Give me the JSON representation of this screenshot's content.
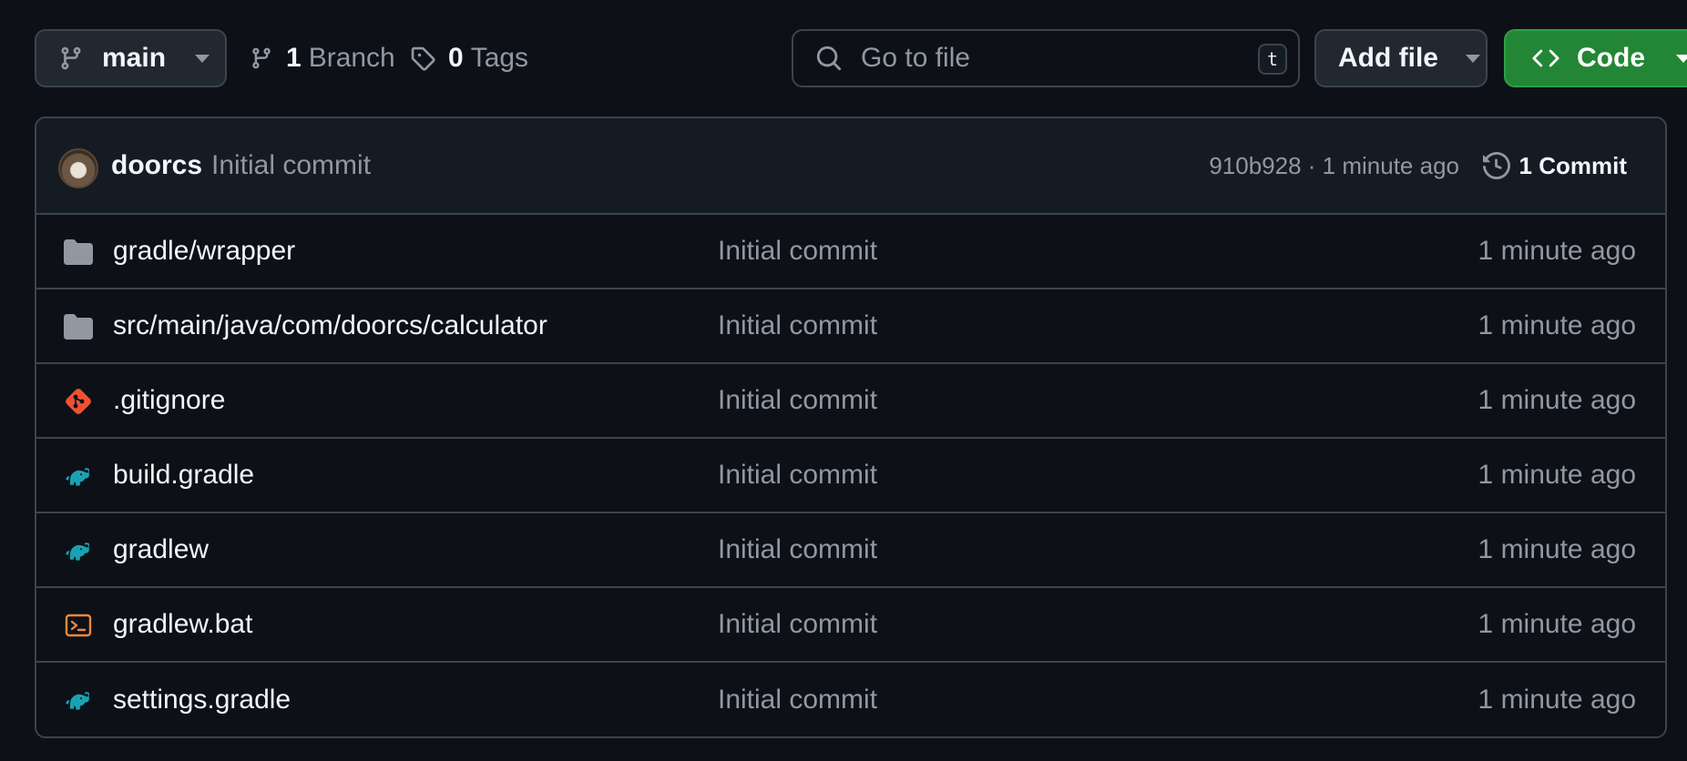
{
  "toolbar": {
    "branch": "main",
    "branch_count": "1",
    "branch_label": "Branch",
    "tag_count": "0",
    "tag_label": "Tags",
    "search_placeholder": "Go to file",
    "search_shortcut": "t",
    "add_file_label": "Add file",
    "code_label": "Code"
  },
  "latest_commit": {
    "author": "doorcs",
    "message": "Initial commit",
    "sha": "910b928",
    "separator": " · ",
    "time": "1 minute ago",
    "commit_count_label": "1 Commit"
  },
  "files": [
    {
      "name": "gradle/wrapper",
      "icon": "folder-icon",
      "message": "Initial commit",
      "time": "1 minute ago"
    },
    {
      "name": "src/main/java/com/doorcs/calculator",
      "icon": "folder-icon",
      "message": "Initial commit",
      "time": "1 minute ago"
    },
    {
      "name": ".gitignore",
      "icon": "git-icon",
      "message": "Initial commit",
      "time": "1 minute ago"
    },
    {
      "name": "build.gradle",
      "icon": "gradle-icon",
      "message": "Initial commit",
      "time": "1 minute ago"
    },
    {
      "name": "gradlew",
      "icon": "gradle-icon",
      "message": "Initial commit",
      "time": "1 minute ago"
    },
    {
      "name": "gradlew.bat",
      "icon": "terminal-icon",
      "message": "Initial commit",
      "time": "1 minute ago"
    },
    {
      "name": "settings.gradle",
      "icon": "gradle-icon",
      "message": "Initial commit",
      "time": "1 minute ago"
    }
  ],
  "colors": {
    "background": "#0d1117",
    "border": "#3d444d",
    "code_button": "#238636",
    "folder_icon": "#9198a1",
    "git_icon": "#f05032",
    "gradle_icon": "#02303a",
    "gradle_icon_accent": "#1ba1b4",
    "terminal_icon": "#f0883e"
  }
}
